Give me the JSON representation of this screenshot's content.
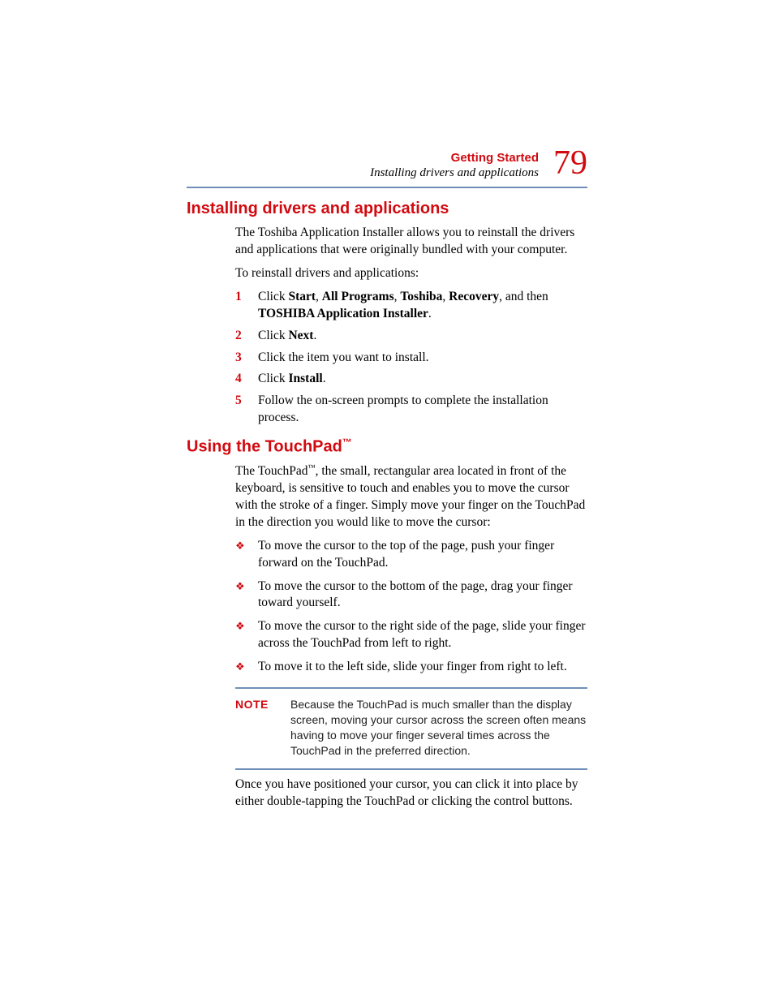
{
  "header": {
    "chapter": "Getting Started",
    "section": "Installing drivers and applications",
    "page_number": "79"
  },
  "section1": {
    "heading": "Installing drivers and applications",
    "intro": "The Toshiba Application Installer allows you to reinstall the drivers and applications that were originally bundled with your computer.",
    "lead": "To reinstall drivers and applications:",
    "steps": {
      "n1": "1",
      "s1_a": "Click ",
      "s1_b": "Start",
      "s1_c": ", ",
      "s1_d": "All Programs",
      "s1_e": ", ",
      "s1_f": "Toshiba",
      "s1_g": ", ",
      "s1_h": "Recovery",
      "s1_i": ", and then ",
      "s1_j": "TOSHIBA Application Installer",
      "s1_k": ".",
      "n2": "2",
      "s2_a": "Click ",
      "s2_b": "Next",
      "s2_c": ".",
      "n3": "3",
      "s3": "Click the item you want to install.",
      "n4": "4",
      "s4_a": "Click ",
      "s4_b": "Install",
      "s4_c": ".",
      "n5": "5",
      "s5": "Follow the on-screen prompts to complete the installation process."
    }
  },
  "section2": {
    "heading": "Using the TouchPad",
    "tm": "™",
    "intro_a": "The TouchPad",
    "intro_b": ", the small, rectangular area located in front of the keyboard, is sensitive to touch and enables you to move the cursor with the stroke of a finger. Simply move your finger on the TouchPad in the direction you would like to move the cursor:",
    "bullets": {
      "b1": "To move the cursor to the top of the page, push your finger forward on the TouchPad.",
      "b2": "To move the cursor to the bottom of the page, drag your finger toward yourself.",
      "b3": "To move the cursor to the right side of the page, slide your finger across the TouchPad from left to right.",
      "b4": "To move it to the left side, slide your finger from right to left."
    },
    "note_label": "NOTE",
    "note_text": "Because the TouchPad is much smaller than the display screen, moving your cursor across the screen often means having to move your finger several times across the TouchPad in the preferred direction.",
    "closing": "Once you have positioned your cursor, you can click it into place by either double-tapping the TouchPad or clicking the control buttons."
  },
  "glyphs": {
    "diamond": "❖"
  }
}
